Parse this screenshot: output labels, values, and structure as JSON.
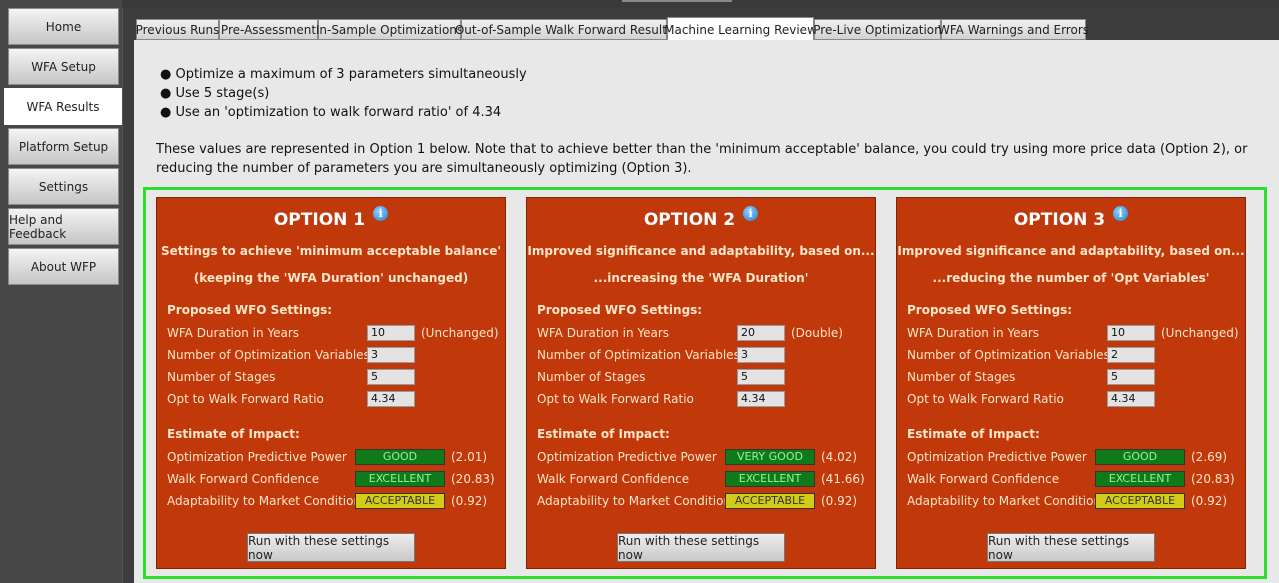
{
  "sidebar": {
    "items": [
      {
        "label": "Home"
      },
      {
        "label": "WFA Setup"
      },
      {
        "label": "WFA Results"
      },
      {
        "label": "Platform Setup"
      },
      {
        "label": "Settings"
      },
      {
        "label": "Help and Feedback"
      },
      {
        "label": "About WFP"
      }
    ],
    "active": "WFA Results"
  },
  "tabs": [
    {
      "label": "Previous Runs"
    },
    {
      "label": "Pre-Assessment"
    },
    {
      "label": "In-Sample Optimizations"
    },
    {
      "label": "Out-of-Sample Walk Forward Results"
    },
    {
      "label": "Machine Learning Review"
    },
    {
      "label": "Pre-Live Optimization"
    },
    {
      "label": "WFA Warnings and Errors"
    }
  ],
  "active_tab": "Machine Learning Review",
  "main": {
    "bullets": [
      "● Optimize a maximum of 3 parameters simultaneously",
      "● Use 5 stage(s)",
      "● Use an 'optimization to walk forward ratio' of 4.34"
    ],
    "paragraph": "These values are represented in Option 1 below. Note that to achieve better than the 'minimum acceptable' balance, you could try using more price data (Option 2), or reducing the number of parameters you are simultaneously optimizing (Option 3).",
    "labels": {
      "proposed": "Proposed WFO Settings:",
      "duration": "WFA Duration in Years",
      "num_vars": "Number of Optimization Variables",
      "stages": "Number of Stages",
      "ratio": "Opt to Walk Forward Ratio",
      "impact": "Estimate of Impact:",
      "predictive": "Optimization Predictive Power",
      "confidence": "Walk Forward Confidence",
      "adaptability": "Adaptability to Market Conditions",
      "run_button": "Run with these settings now"
    },
    "options": [
      {
        "title": "OPTION 1",
        "subtitle1": "Settings to achieve 'minimum acceptable balance'",
        "subtitle2": "(keeping the 'WFA Duration' unchanged)",
        "duration": "10",
        "duration_note": "(Unchanged)",
        "num_vars": "3",
        "stages": "5",
        "ratio": "4.34",
        "predictive_badge": "GOOD",
        "predictive_val": "(2.01)",
        "confidence_badge": "EXCELLENT",
        "confidence_val": "(20.83)",
        "adaptability_badge": "ACCEPTABLE",
        "adaptability_val": "(0.92)"
      },
      {
        "title": "OPTION 2",
        "subtitle1": "Improved significance and adaptability, based on...",
        "subtitle2": "...increasing the 'WFA Duration'",
        "duration": "20",
        "duration_note": "(Double)",
        "num_vars": "3",
        "stages": "5",
        "ratio": "4.34",
        "predictive_badge": "VERY GOOD",
        "predictive_val": "(4.02)",
        "confidence_badge": "EXCELLENT",
        "confidence_val": "(41.66)",
        "adaptability_badge": "ACCEPTABLE",
        "adaptability_val": "(0.92)"
      },
      {
        "title": "OPTION 3",
        "subtitle1": "Improved significance and adaptability, based on...",
        "subtitle2": "...reducing the number of 'Opt Variables'",
        "duration": "10",
        "duration_note": "(Unchanged)",
        "num_vars": "2",
        "stages": "5",
        "ratio": "4.34",
        "predictive_badge": "GOOD",
        "predictive_val": "(2.69)",
        "confidence_badge": "EXCELLENT",
        "confidence_val": "(20.83)",
        "adaptability_badge": "ACCEPTABLE",
        "adaptability_val": "(0.92)"
      }
    ]
  },
  "colors": {
    "card_bg": "#c1380b",
    "frame": "#2be02b",
    "badge_green": "#0f7a1a",
    "badge_yellow": "#d2cc16",
    "info_icon": "#1f7fd6"
  }
}
